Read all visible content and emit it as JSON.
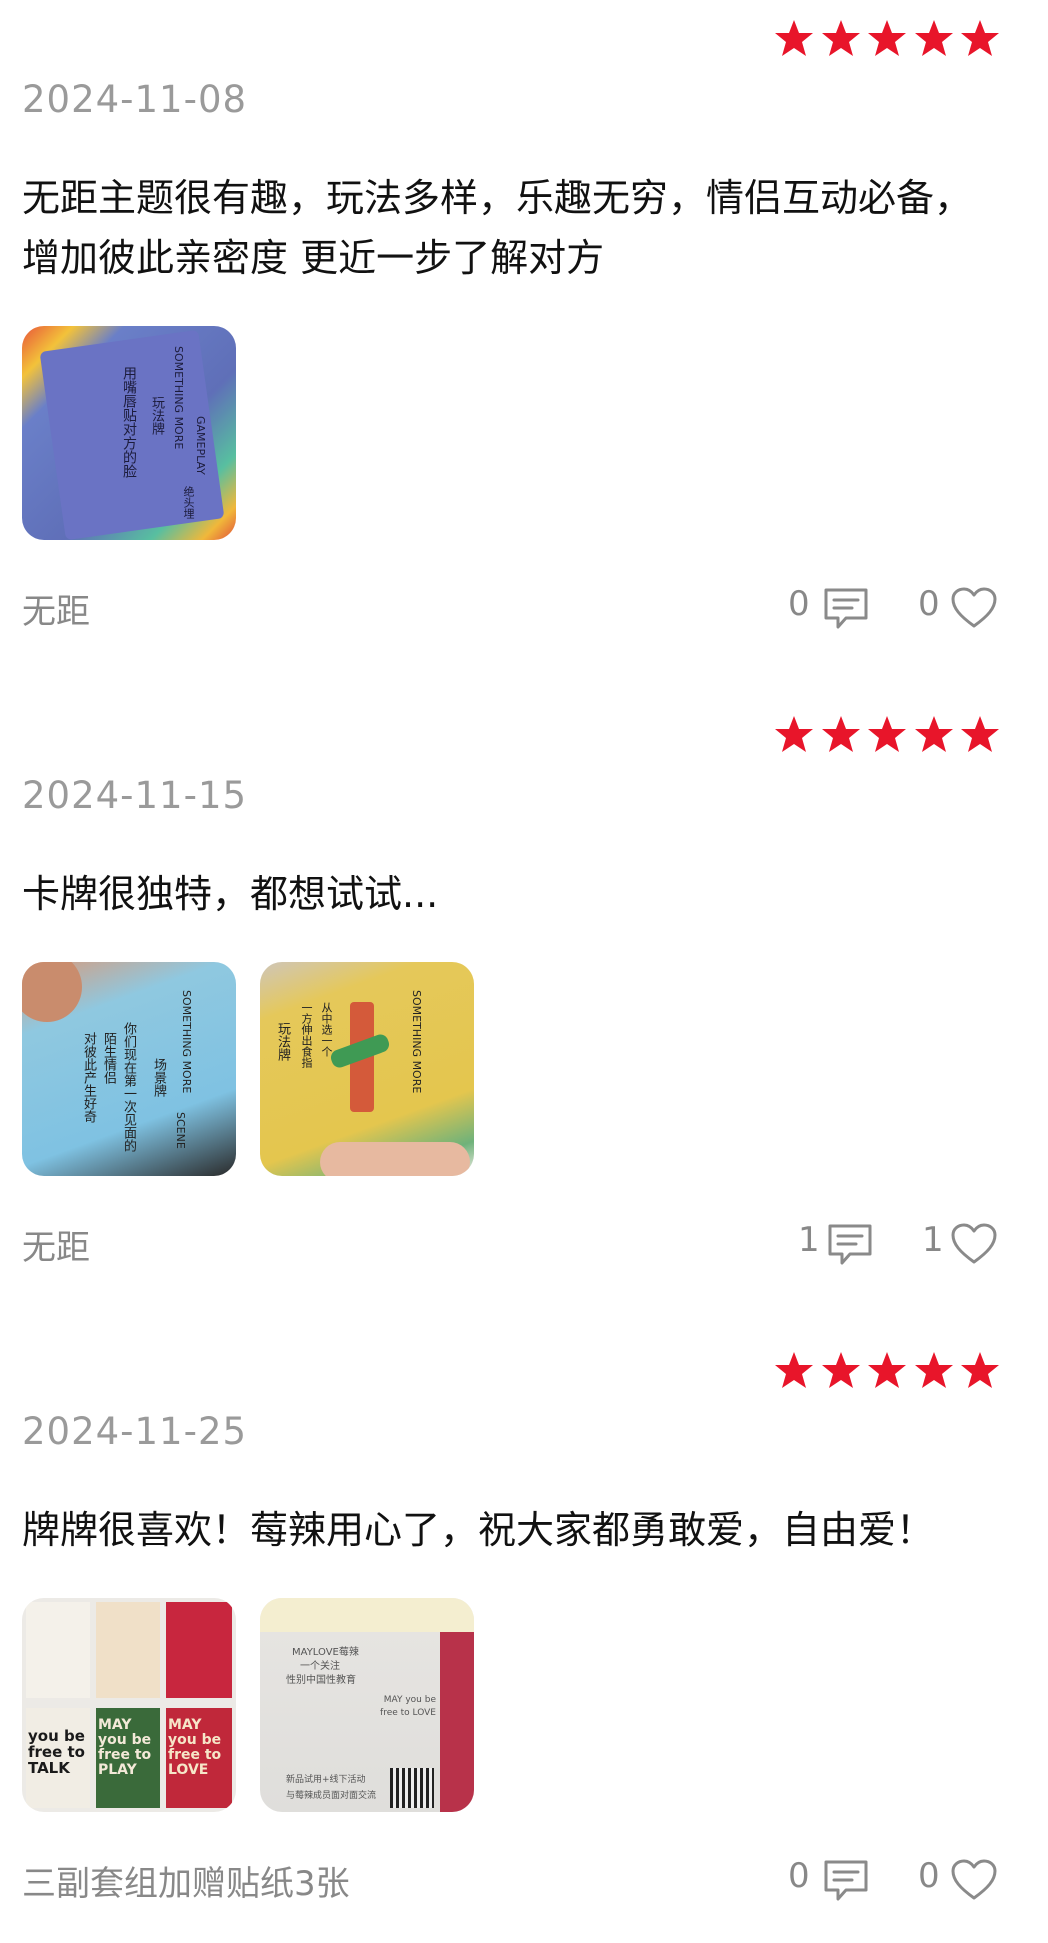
{
  "reviews": [
    {
      "stars": 5,
      "date": "2024-11-08",
      "text": "无距主题很有趣，玩法多样，乐趣无穷，情侣互动必备，增加彼此亲密度 更近一步了解对方",
      "tag": "无距",
      "comments": "0",
      "likes": "0",
      "images": [
        {
          "texts": [
            "SOMETHING MORE",
            "玩法牌",
            "GAMEPLAY",
            "用嘴唇贴对方的脸",
            "绝头埋"
          ]
        }
      ]
    },
    {
      "stars": 5,
      "date": "2024-11-15",
      "text": "卡牌很独特，都想试试...",
      "tag": "无距",
      "comments": "1",
      "likes": "1",
      "images": [
        {
          "texts": [
            "SOMETHING MORE",
            "场景牌",
            "SCENE",
            "你们现在第一次见面的",
            "陌生情侣",
            "对彼此产生好奇"
          ]
        },
        {
          "texts": [
            "SOMETHING MORE",
            "玩法牌",
            "一方伸出食指",
            "从中选一个"
          ]
        }
      ]
    },
    {
      "stars": 5,
      "date": "2024-11-25",
      "text": "牌牌很喜欢！莓辣用心了，祝大家都勇敢爱，自由爱！",
      "tag": "三副套组加赠贴纸3张",
      "comments": "0",
      "likes": "0",
      "images": [
        {
          "texts": [
            "you be free to TALK",
            "MAY you be free to PLAY",
            "MAY you be free to LOVE"
          ]
        },
        {
          "texts": [
            "MAYLOVE莓辣",
            "一个关注",
            "性别中国性教育",
            "MAY you be free to LOVE",
            "新品试用+线下活动",
            "与莓辣成员面对面交流"
          ]
        }
      ]
    }
  ],
  "colors": {
    "star": "#e8152a",
    "date": "#9a9a9a",
    "meta": "#888888"
  }
}
